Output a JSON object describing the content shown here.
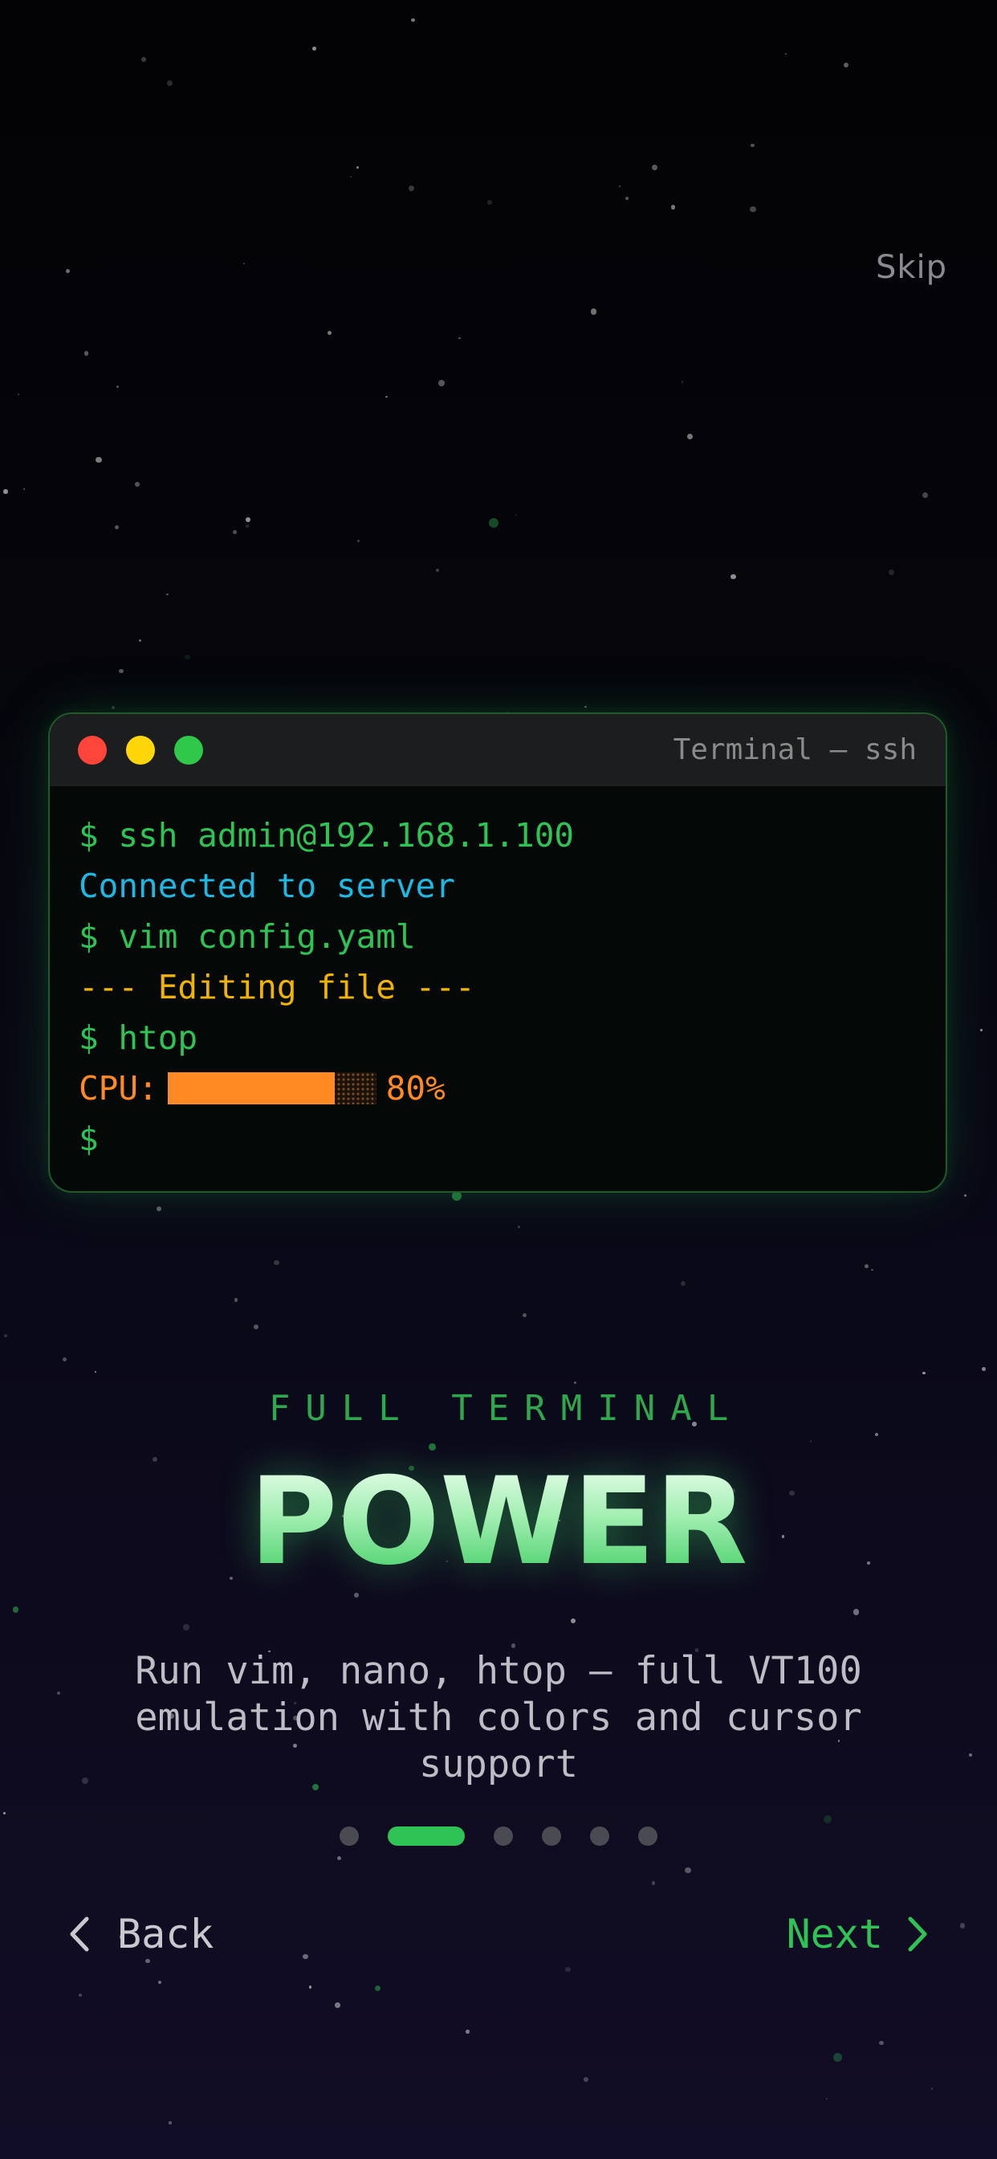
{
  "header": {
    "skip_label": "Skip"
  },
  "terminal": {
    "window_title": "Terminal — ssh",
    "lines": {
      "l1": "$ ssh admin@192.168.1.100",
      "l2": "Connected to server",
      "l3": "$ vim config.yaml",
      "l4": "--- Editing file ---",
      "l5": "$ htop",
      "cpu_label": "CPU:",
      "cpu_value": "80%",
      "prompt": "$"
    },
    "cpu_fraction": 0.8,
    "colors": {
      "command": "#2fc356",
      "info": "#1fb8e3",
      "editor": "#f0b400",
      "cpu": "#ff8a24"
    }
  },
  "slide": {
    "eyebrow": "FULL TERMINAL",
    "title": "POWER",
    "description": "Run vim, nano, htop — full VT100 emulation with colors and cursor support"
  },
  "pager": {
    "count": 6,
    "active_index": 1
  },
  "navigation": {
    "back_label": "Back",
    "next_label": "Next",
    "back_icon": "chevron-left-icon",
    "next_icon": "chevron-right-icon"
  },
  "theme": {
    "accent": "#2fc356",
    "background": "#05050b"
  }
}
